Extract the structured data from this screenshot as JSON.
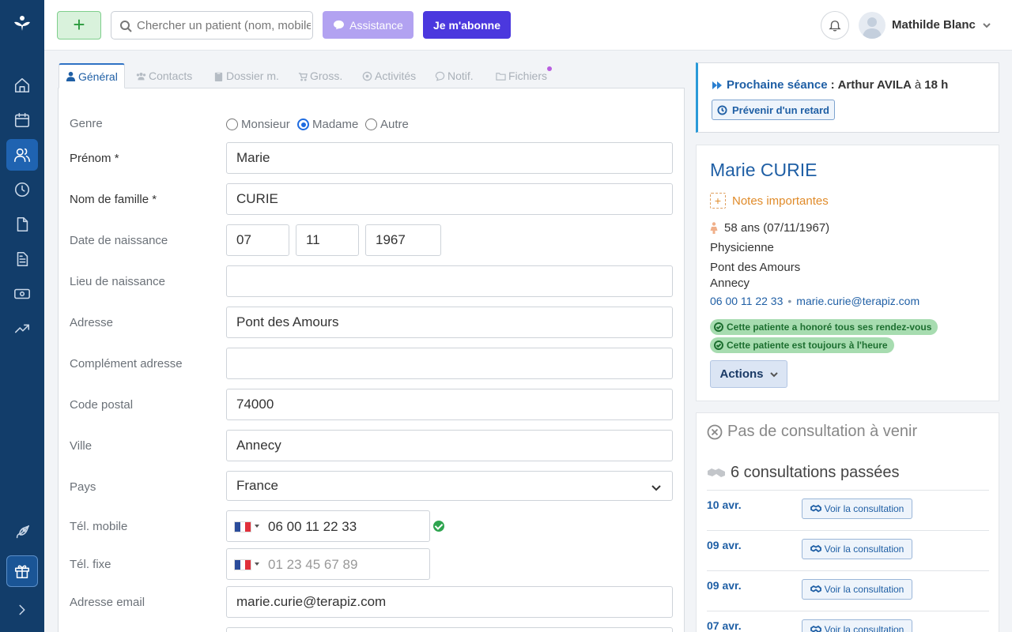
{
  "topbar": {
    "add_label": "+",
    "search_placeholder": "Chercher un patient (nom, mobile...)",
    "assist_label": "Assistance",
    "subscribe_label": "Je m'abonne",
    "user_name": "Mathilde Blanc"
  },
  "sidebar": {
    "items": [
      "home-icon",
      "calendar-icon",
      "patients-icon",
      "clock-icon",
      "document-icon",
      "invoice-icon",
      "money-icon",
      "stats-icon",
      "rocket-icon",
      "gift-icon",
      "expand-icon"
    ],
    "active": "patients-icon"
  },
  "tabs": [
    {
      "label": "Général",
      "icon": "user-icon",
      "active": true
    },
    {
      "label": "Contacts",
      "icon": "users-icon"
    },
    {
      "label": "Dossier m.",
      "icon": "clipboard-icon"
    },
    {
      "label": "Gross.",
      "icon": "stroller-icon"
    },
    {
      "label": "Activités",
      "icon": "ball-icon"
    },
    {
      "label": "Notif.",
      "icon": "chat-icon"
    },
    {
      "label": "Fichiers",
      "icon": "folder-icon"
    }
  ],
  "form": {
    "genre_label": "Genre",
    "genre_options": [
      "Monsieur",
      "Madame",
      "Autre"
    ],
    "genre_selected": "Madame",
    "prenom_label": "Prénom *",
    "prenom_value": "Marie",
    "nom_label": "Nom de famille *",
    "nom_value": "CURIE",
    "dob_label": "Date de naissance",
    "dob_day": "07",
    "dob_month": "11",
    "dob_year": "1967",
    "lieu_label": "Lieu de naissance",
    "lieu_value": "",
    "adresse_label": "Adresse",
    "adresse_value": "Pont des Amours",
    "complement_label": "Complément adresse",
    "complement_value": "",
    "cp_label": "Code postal",
    "cp_value": "74000",
    "ville_label": "Ville",
    "ville_value": "Annecy",
    "pays_label": "Pays",
    "pays_value": "France",
    "mobile_label": "Tél. mobile",
    "mobile_value": "06 00 11 22 33",
    "fixe_label": "Tél. fixe",
    "fixe_placeholder": "01 23 45 67 89",
    "email_label": "Adresse email",
    "email_value": "marie.curie@terapiz.com"
  },
  "next_session": {
    "label": "Prochaine séance",
    "separator": ":",
    "patient": "Arthur AVILA",
    "at": "à",
    "time": "18 h",
    "late_button": "Prévenir d'un retard"
  },
  "patient": {
    "name": "Marie CURIE",
    "notes_label": "Notes importantes",
    "age": "58 ans (07/11/1967)",
    "profession": "Physicienne",
    "address_line": "Pont des Amours",
    "city": "Annecy",
    "phone": "06 00 11 22 33",
    "separator": "•",
    "email": "marie.curie@terapiz.com",
    "badges": [
      "Cette patiente a honoré tous ses rendez-vous",
      "Cette patiente est toujours à l'heure"
    ],
    "actions_label": "Actions"
  },
  "consultations": {
    "none_upcoming": "Pas de consultation à venir",
    "past_title": "6 consultations passées",
    "button_label": "Voir la consultation",
    "rows": [
      {
        "date": "10 avr."
      },
      {
        "date": "09 avr."
      },
      {
        "date": "09 avr."
      },
      {
        "date": "07 avr."
      }
    ]
  },
  "colors": {
    "sidebar": "#123d6a",
    "accent": "#1f5fa5",
    "subscribe": "#4b38de",
    "assist": "#b2a2f1",
    "success": "#2ea44f"
  }
}
